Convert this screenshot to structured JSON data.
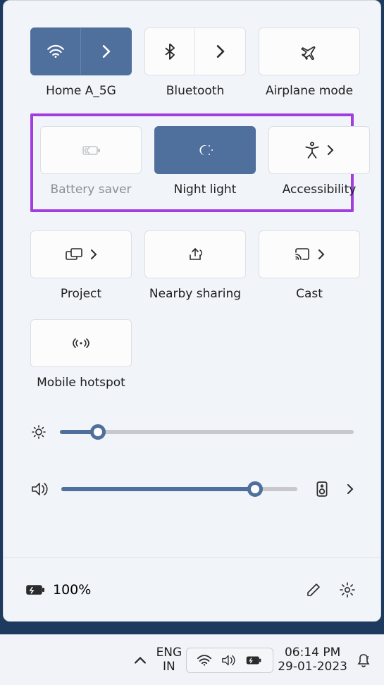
{
  "tiles": {
    "wifi": {
      "label": "Home A_5G",
      "active": true,
      "has_expand": true
    },
    "bluetooth": {
      "label": "Bluetooth",
      "active": false,
      "has_expand": true
    },
    "airplane": {
      "label": "Airplane mode",
      "active": false
    },
    "battery_saver": {
      "label": "Battery saver",
      "active": false,
      "disabled": true
    },
    "night_light": {
      "label": "Night light",
      "active": true
    },
    "accessibility": {
      "label": "Accessibility",
      "active": false,
      "has_expand": true
    },
    "project": {
      "label": "Project",
      "active": false,
      "has_expand": true
    },
    "nearby": {
      "label": "Nearby sharing",
      "active": false
    },
    "cast": {
      "label": "Cast",
      "active": false,
      "has_expand": true
    },
    "hotspot": {
      "label": "Mobile hotspot",
      "active": false
    }
  },
  "sliders": {
    "brightness": {
      "value": 13
    },
    "volume": {
      "value": 82
    }
  },
  "footer": {
    "battery_text": "100%"
  },
  "taskbar": {
    "lang1": "ENG",
    "lang2": "IN",
    "time": "06:14 PM",
    "date": "29-01-2023"
  }
}
